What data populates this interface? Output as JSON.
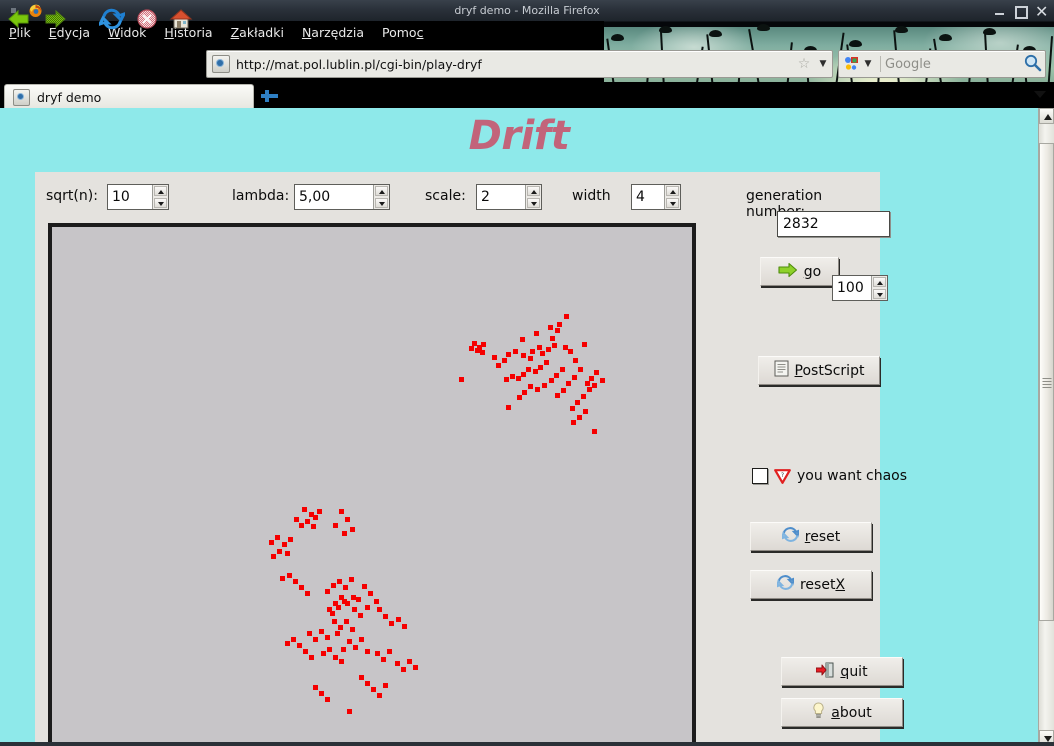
{
  "window": {
    "title": "dryf demo - Mozilla Firefox",
    "minimize_label": "minimize",
    "maximize_label": "maximize",
    "close_label": "close"
  },
  "menubar": {
    "items": [
      {
        "pre": "",
        "accel": "P",
        "post": "lik"
      },
      {
        "pre": "",
        "accel": "E",
        "post": "dycja"
      },
      {
        "pre": "",
        "accel": "W",
        "post": "idok"
      },
      {
        "pre": "",
        "accel": "H",
        "post": "istoria"
      },
      {
        "pre": "",
        "accel": "Z",
        "post": "akładki"
      },
      {
        "pre": "",
        "accel": "N",
        "post": "arzędzia"
      },
      {
        "pre": "Pomo",
        "accel": "c",
        "post": ""
      }
    ]
  },
  "toolbar": {
    "back_label": "Back",
    "forward_label": "Forward",
    "reload_label": "Reload",
    "stop_label": "Stop",
    "home_label": "Home",
    "url": "http://mat.pol.lublin.pl/cgi-bin/play-dryf",
    "bookmark_label": "Bookmark this page",
    "url_dropdown_label": "History dropdown",
    "search_placeholder": "Google",
    "search_engine_label": "Google",
    "search_go_label": "Search"
  },
  "tabs": {
    "open": [
      {
        "label": "dryf demo",
        "active": true
      }
    ],
    "new_tab_label": "New Tab",
    "list_all_label": "List all tabs"
  },
  "page": {
    "title": "Drift",
    "title_color": "#c2647a",
    "background_color": "#8ee9ea",
    "panel_color": "#e4e2de",
    "canvas_color": "#c7c5c8",
    "point_color": "#f50000"
  },
  "controls": {
    "sqrt_n": {
      "label": "sqrt(n):",
      "value": "10"
    },
    "lambda": {
      "label": "lambda:",
      "value": "5,00"
    },
    "scale": {
      "label": "scale:",
      "value": "2"
    },
    "width": {
      "label": "width",
      "value": "4"
    },
    "generation": {
      "label": "generation number:",
      "value": "2832"
    },
    "steps": {
      "value": "100"
    }
  },
  "buttons": {
    "go": {
      "pre": "",
      "accel": "g",
      "post": "o",
      "icon": "green-right-arrow-icon"
    },
    "postscript": {
      "pre": "",
      "accel": "P",
      "post": "ostScript",
      "icon": "document-icon"
    },
    "reset": {
      "pre": "",
      "accel": "r",
      "post": "eset",
      "icon": "refresh-icon"
    },
    "resetx": {
      "pre": "reset",
      "accel": "X",
      "post": "",
      "icon": "refresh-icon"
    },
    "quit": {
      "pre": "",
      "accel": "q",
      "post": "uit",
      "icon": "exit-door-icon"
    },
    "about": {
      "pre": "",
      "accel": "a",
      "post": "bout",
      "icon": "lightbulb-icon"
    }
  },
  "chaos": {
    "label": "you want chaos",
    "checked": false,
    "icon": "warning-triangle-icon"
  },
  "scatter": {
    "cluster_a": [
      [
        122,
        57
      ],
      [
        115,
        65
      ],
      [
        113,
        71
      ],
      [
        108,
        79
      ],
      [
        110,
        86
      ],
      [
        104,
        90
      ],
      [
        98,
        94
      ],
      [
        95,
        88
      ],
      [
        88,
        92
      ],
      [
        86,
        99
      ],
      [
        79,
        96
      ],
      [
        71,
        92
      ],
      [
        64,
        95
      ],
      [
        60,
        101
      ],
      [
        54,
        106
      ],
      [
        50,
        98
      ],
      [
        102,
        103
      ],
      [
        96,
        108
      ],
      [
        91,
        112
      ],
      [
        84,
        110
      ],
      [
        79,
        115
      ],
      [
        74,
        119
      ],
      [
        68,
        117
      ],
      [
        62,
        120
      ],
      [
        118,
        110
      ],
      [
        112,
        116
      ],
      [
        107,
        121
      ],
      [
        100,
        126
      ],
      [
        93,
        130
      ],
      [
        86,
        127
      ],
      [
        80,
        133
      ],
      [
        75,
        138
      ],
      [
        126,
        92
      ],
      [
        131,
        101
      ],
      [
        136,
        110
      ],
      [
        130,
        118
      ],
      [
        124,
        124
      ],
      [
        119,
        131
      ],
      [
        113,
        136
      ],
      [
        145,
        130
      ],
      [
        139,
        137
      ],
      [
        133,
        143
      ],
      [
        128,
        149
      ],
      [
        141,
        152
      ],
      [
        135,
        158
      ],
      [
        129,
        163
      ],
      [
        152,
        113
      ],
      [
        158,
        121
      ],
      [
        147,
        119
      ],
      [
        150,
        126
      ],
      [
        143,
        124
      ],
      [
        30,
        84
      ],
      [
        35,
        88
      ],
      [
        39,
        85
      ],
      [
        33,
        91
      ],
      [
        38,
        93
      ],
      [
        27,
        89
      ],
      [
        17,
        120
      ],
      [
        64,
        148
      ],
      [
        150,
        172
      ],
      [
        121,
        88
      ],
      [
        106,
        68
      ],
      [
        92,
        74
      ],
      [
        78,
        80
      ],
      [
        140,
        85
      ]
    ],
    "cluster_b": [
      [
        55,
        28
      ],
      [
        62,
        33
      ],
      [
        58,
        40
      ],
      [
        66,
        36
      ],
      [
        52,
        44
      ],
      [
        47,
        38
      ],
      [
        70,
        30
      ],
      [
        64,
        45
      ],
      [
        22,
        61
      ],
      [
        28,
        56
      ],
      [
        35,
        63
      ],
      [
        41,
        58
      ],
      [
        30,
        70
      ],
      [
        24,
        75
      ],
      [
        38,
        72
      ],
      [
        92,
        30
      ],
      [
        98,
        38
      ],
      [
        86,
        44
      ],
      [
        103,
        48
      ],
      [
        95,
        52
      ],
      [
        40,
        94
      ],
      [
        46,
        100
      ],
      [
        33,
        97
      ],
      [
        52,
        106
      ],
      [
        58,
        112
      ],
      [
        115,
        105
      ],
      [
        121,
        112
      ],
      [
        109,
        118
      ],
      [
        127,
        120
      ],
      [
        118,
        126
      ],
      [
        85,
        140
      ],
      [
        91,
        146
      ],
      [
        97,
        140
      ],
      [
        103,
        148
      ],
      [
        88,
        152
      ],
      [
        72,
        150
      ],
      [
        78,
        156
      ],
      [
        66,
        158
      ],
      [
        60,
        152
      ],
      [
        130,
        128
      ],
      [
        136,
        135
      ],
      [
        142,
        142
      ],
      [
        149,
        138
      ],
      [
        155,
        145
      ],
      [
        100,
        160
      ],
      [
        106,
        166
      ],
      [
        112,
        158
      ],
      [
        94,
        168
      ],
      [
        118,
        170
      ],
      [
        80,
        168
      ],
      [
        74,
        172
      ],
      [
        86,
        176
      ],
      [
        92,
        180
      ],
      [
        44,
        158
      ],
      [
        50,
        164
      ],
      [
        38,
        162
      ],
      [
        56,
        170
      ],
      [
        62,
        176
      ],
      [
        128,
        172
      ],
      [
        134,
        178
      ],
      [
        140,
        170
      ],
      [
        148,
        182
      ],
      [
        154,
        188
      ],
      [
        160,
        180
      ],
      [
        166,
        186
      ],
      [
        112,
        196
      ],
      [
        118,
        202
      ],
      [
        124,
        208
      ],
      [
        130,
        214
      ],
      [
        136,
        204
      ],
      [
        72,
        212
      ],
      [
        66,
        206
      ],
      [
        78,
        218
      ],
      [
        100,
        230
      ],
      [
        95,
        120
      ],
      [
        89,
        126
      ],
      [
        83,
        132
      ],
      [
        105,
        128
      ],
      [
        111,
        134
      ],
      [
        92,
        116
      ],
      [
        98,
        122
      ],
      [
        104,
        116
      ],
      [
        86,
        122
      ],
      [
        80,
        128
      ],
      [
        90,
        100
      ],
      [
        96,
        106
      ],
      [
        84,
        104
      ],
      [
        78,
        110
      ],
      [
        102,
        98
      ]
    ]
  }
}
